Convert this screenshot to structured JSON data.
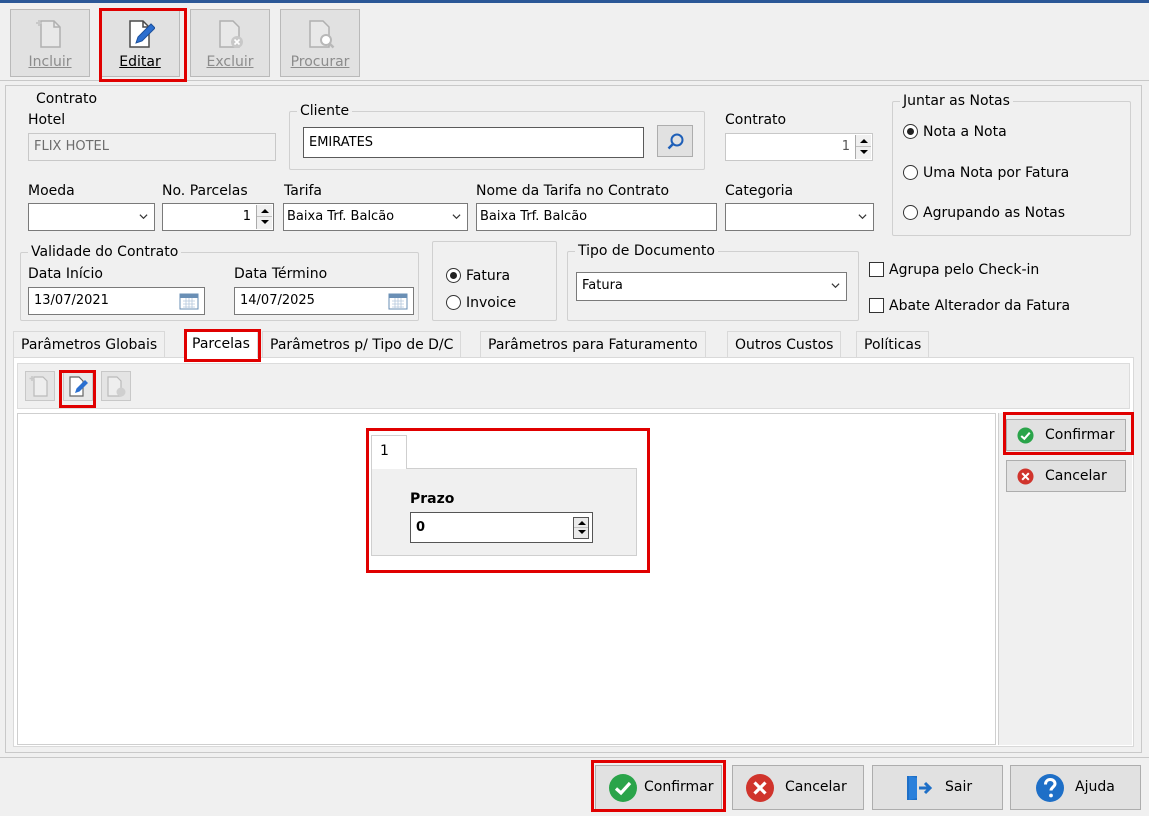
{
  "toolbar": {
    "buttons": [
      {
        "label": "Incluir",
        "enabled": false
      },
      {
        "label": "Editar",
        "enabled": true
      },
      {
        "label": "Excluir",
        "enabled": false
      },
      {
        "label": "Procurar",
        "enabled": false
      }
    ]
  },
  "contrato_group": {
    "legend": "Contrato",
    "hotel_label": "Hotel",
    "hotel_value": "FLIX HOTEL"
  },
  "cliente_group": {
    "legend": "Cliente",
    "value": "EMIRATES"
  },
  "contrato_field": {
    "label": "Contrato",
    "value": "1"
  },
  "juntar": {
    "legend": "Juntar as Notas",
    "options": [
      "Nota a Nota",
      "Uma Nota por Fatura",
      "Agrupando as Notas"
    ],
    "selected": "Nota a Nota"
  },
  "moeda": {
    "label": "Moeda",
    "value": ""
  },
  "parcelas": {
    "label": "No. Parcelas",
    "value": "1"
  },
  "tarifa": {
    "label": "Tarifa",
    "value": "Baixa Trf. Balcão"
  },
  "nome_tarifa": {
    "label": "Nome da Tarifa no Contrato",
    "value": "Baixa Trf. Balcão"
  },
  "categoria": {
    "label": "Categoria",
    "value": ""
  },
  "validade": {
    "legend": "Validade do Contrato",
    "inicio_label": "Data Início",
    "inicio_value": "13/07/2021",
    "termino_label": "Data Término",
    "termino_value": "14/07/2025"
  },
  "doc_radio": {
    "options": [
      "Fatura",
      "Invoice"
    ],
    "selected": "Fatura"
  },
  "tipo_documento": {
    "legend": "Tipo de Documento",
    "value": "Fatura"
  },
  "checks": {
    "agrupa_checkin": "Agrupa pelo Check-in",
    "abate_alterador": "Abate Alterador da Fatura"
  },
  "tabs": [
    "Parâmetros Globais",
    "Parcelas",
    "Parâmetros p/ Tipo de D/C",
    "Parâmetros para Faturamento",
    "Outros Custos",
    "Políticas"
  ],
  "selected_tab": "Parcelas",
  "parcela": {
    "tab_label": "1",
    "prazo_label": "Prazo",
    "prazo_value": "0"
  },
  "side_buttons": {
    "confirmar": "Confirmar",
    "cancelar": "Cancelar"
  },
  "bottom_buttons": {
    "confirmar": "Confirmar",
    "cancelar": "Cancelar",
    "sair": "Sair",
    "ajuda": "Ajuda"
  },
  "colors": {
    "highlight": "#e00000",
    "confirm_green": "#2aa44a",
    "cancel_red": "#d0342c",
    "help_blue": "#1e6fc7",
    "edit_blue": "#2b6fd0"
  }
}
